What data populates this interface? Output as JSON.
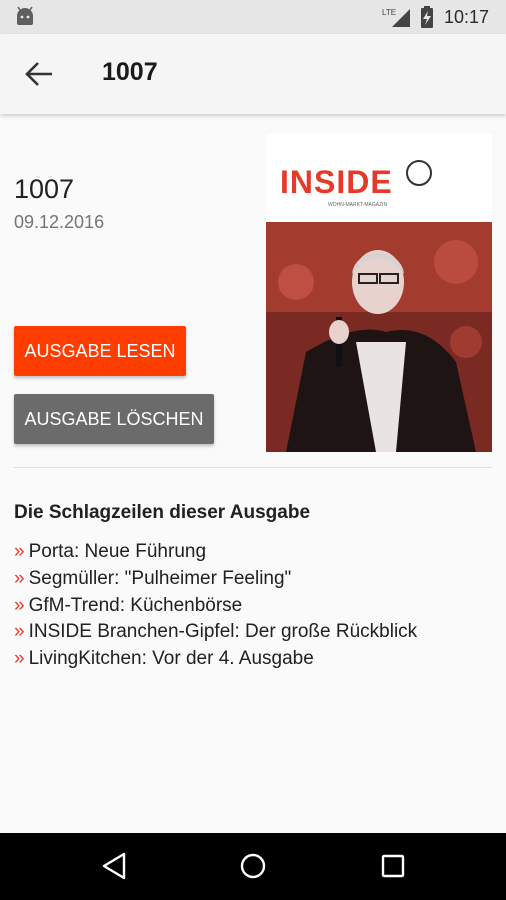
{
  "status_bar": {
    "time": "10:17",
    "network": "LTE",
    "icons": [
      "android-debug-icon",
      "lte-signal-icon",
      "battery-charging-icon"
    ]
  },
  "app_bar": {
    "title": "1007",
    "back_icon": "arrow-left-icon"
  },
  "issue": {
    "title": "1007",
    "date": "09.12.2016",
    "cover": {
      "brand": "INSIDE",
      "subtitle": "WOHN-MARKT-MAGAZIN"
    }
  },
  "actions": {
    "read_label": "AUSGABE LESEN",
    "delete_label": "AUSGABE LÖSCHEN"
  },
  "headlines": {
    "title": "Die Schlagzeilen dieser Ausgabe",
    "bullet": "»",
    "items": [
      "Porta: Neue Führung",
      "Segmüller: \"Pulheimer Feeling\"",
      "GfM-Trend: Küchenbörse",
      "INSIDE Branchen-Gipfel: Der große Rückblick",
      "LivingKitchen: Vor der 4. Ausgabe"
    ]
  },
  "nav_bar": {
    "icons": [
      "back-triangle-icon",
      "home-circle-icon",
      "recents-square-icon"
    ]
  },
  "colors": {
    "accent": "#ff3d00",
    "secondary_button": "#6b6b6b",
    "bullet": "#e53a2a"
  }
}
